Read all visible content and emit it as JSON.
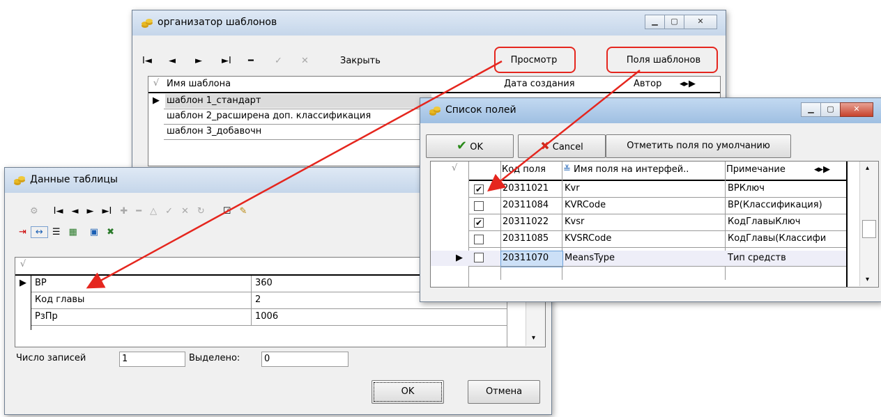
{
  "organizer": {
    "title": "организатор шаблонов",
    "toolbar": {
      "first": "I◄",
      "prev": "◄",
      "next": "►",
      "last": "►I",
      "delete": "━",
      "post": "✓",
      "cancel": "✕",
      "close": "Закрыть",
      "view": "Просмотр",
      "fields": "Поля шаблонов"
    },
    "columns": {
      "name": "Имя шаблона",
      "date": "Дата создания",
      "author": "Автор"
    },
    "rows": [
      "шаблон 1_стандарт",
      "шаблон 2_расширена доп. классификация",
      "шаблон 3_добавочн"
    ]
  },
  "data_table": {
    "title": "Данные таблицы",
    "rows": [
      {
        "name": "ВР",
        "value": "360"
      },
      {
        "name": "Код главы",
        "value": "2"
      },
      {
        "name": "РзПр",
        "value": "1006"
      }
    ],
    "status": {
      "count_label": "Число записей",
      "count": "1",
      "selected_label": "Выделено:",
      "selected": "0"
    },
    "ok": "OK",
    "cancel": "Отмена"
  },
  "fields_list": {
    "title": "Список полей",
    "ok": "OK",
    "cancel": "Cancel",
    "default": "Отметить поля по умолчанию",
    "columns": {
      "code": "Код поля",
      "name": "Имя поля на интерфей..",
      "note": "Примечание"
    },
    "rows": [
      {
        "checked": true,
        "code": "20311021",
        "name": "Kvr",
        "note": "ВРКлюч"
      },
      {
        "checked": false,
        "code": "20311084",
        "name": "KVRCode",
        "note": "ВР(Классификация)"
      },
      {
        "checked": true,
        "code": "20311022",
        "name": "Kvsr",
        "note": "КодГлавыКлюч"
      },
      {
        "checked": false,
        "code": "20311085",
        "name": "KVSRCode",
        "note": "КодГлавы(Классифи"
      },
      {
        "checked": false,
        "code": "20311070",
        "name": "MeansType",
        "note": "Тип средств"
      }
    ]
  },
  "colors": {
    "annotation": "#e5261e",
    "selected_row": "#dcdcdc",
    "current_row": "#eeeef8"
  }
}
